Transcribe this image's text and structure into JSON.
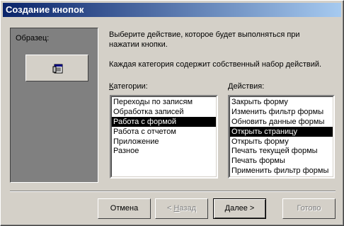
{
  "window": {
    "title": "Создание кнопок"
  },
  "sample": {
    "label": "Образец:",
    "button_icon": "form-icon"
  },
  "description": {
    "line1": "Выберите действие, которое будет выполняться при",
    "line2": "нажатии кнопки.",
    "line3": "Каждая категория содержит собственный набор действий."
  },
  "categories": {
    "label_underlined": "К",
    "label_rest": "атегории:",
    "items": [
      "Переходы по записям",
      "Обработка записей",
      "Работа с формой",
      "Работа с отчетом",
      "Приложение",
      "Разное"
    ],
    "selected": "Работа с формой"
  },
  "actions": {
    "label_underlined": "Д",
    "label_rest": "ействия:",
    "items": [
      "Закрыть форму",
      "Изменить фильтр формы",
      "Обновить данные формы",
      "Открыть страницу",
      "Открыть форму",
      "Печать текущей формы",
      "Печать формы",
      "Применить фильтр формы"
    ],
    "selected": "Открыть страницу"
  },
  "buttons": {
    "cancel": "Отмена",
    "back_prefix": "< ",
    "back_underlined": "Н",
    "back_rest": "азад",
    "next_underlined": "Д",
    "next_rest": "алее >",
    "finish": "Готово"
  }
}
